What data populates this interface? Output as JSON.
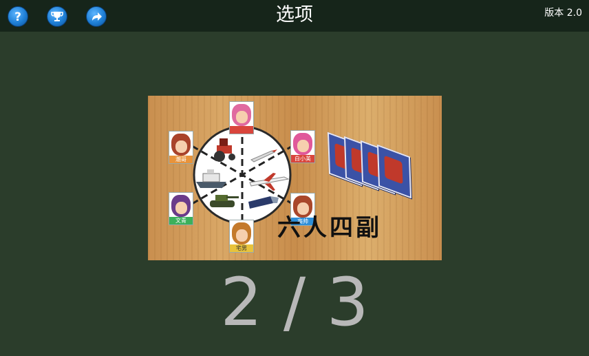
{
  "header": {
    "title": "选项",
    "version": "版本 2.0",
    "buttons": [
      {
        "name": "help-button",
        "icon": "question-mark-icon"
      },
      {
        "name": "achievements-button",
        "icon": "trophy-icon"
      },
      {
        "name": "share-button",
        "icon": "share-arrow-icon"
      }
    ]
  },
  "mode_card": {
    "deck_text": "六人四副",
    "players": [
      {
        "label": "",
        "hair": "#e06aa0",
        "tag": "#d9453c"
      },
      {
        "label": "白小美",
        "hair": "#e0589a",
        "tag": "#d9453c"
      },
      {
        "label": "高帅",
        "hair": "#a9472b",
        "tag": "#2f8fd8"
      },
      {
        "label": "宅男",
        "hair": "#c47a2c",
        "tag": "#e8c23b"
      },
      {
        "label": "文青",
        "hair": "#6a3b8a",
        "tag": "#3bb05b"
      },
      {
        "label": "潮哥",
        "hair": "#a9432b",
        "tag": "#e8933b"
      }
    ],
    "vehicles": [
      "tractor-icon",
      "missile-icon",
      "ship-icon",
      "airplane-icon",
      "tank-icon",
      "train-icon"
    ]
  },
  "pagination": {
    "current": "2",
    "separator": "/",
    "total": "3"
  },
  "colors": {
    "background": "#2b3d2b",
    "topbar": "#16251a",
    "accent": "#1e7fd6"
  }
}
